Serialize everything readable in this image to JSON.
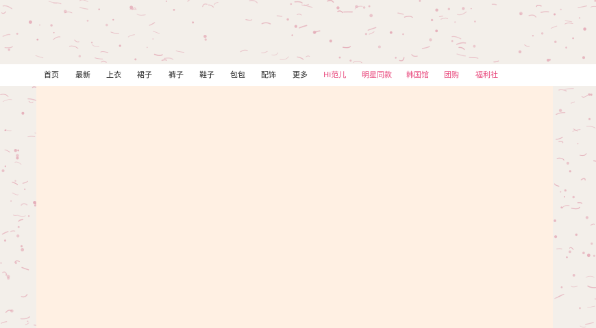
{
  "nav": {
    "items": [
      {
        "label": "首页",
        "highlight": false
      },
      {
        "label": "最新",
        "highlight": false
      },
      {
        "label": "上衣",
        "highlight": false
      },
      {
        "label": "裙子",
        "highlight": false
      },
      {
        "label": "裤子",
        "highlight": false
      },
      {
        "label": "鞋子",
        "highlight": false
      },
      {
        "label": "包包",
        "highlight": false
      },
      {
        "label": "配饰",
        "highlight": false
      },
      {
        "label": "更多",
        "highlight": false
      },
      {
        "label": "Hi范儿",
        "highlight": true
      },
      {
        "label": "明星同款",
        "highlight": true
      },
      {
        "label": "韩国馆",
        "highlight": true
      },
      {
        "label": "团购",
        "highlight": true
      },
      {
        "label": "福利社",
        "highlight": true
      }
    ]
  },
  "colors": {
    "background": "#f3efea",
    "content_panel": "#fff0e3",
    "nav_text": "#222222",
    "nav_highlight": "#e8487c",
    "confetti": "#e3a7b4"
  }
}
